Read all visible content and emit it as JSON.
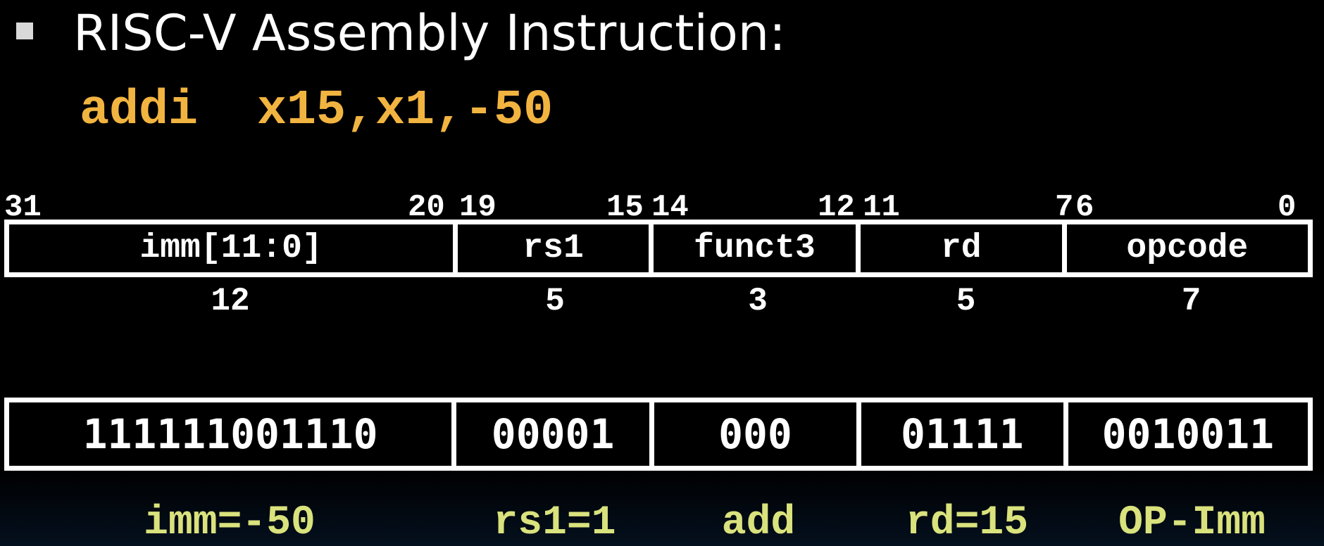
{
  "heading": "RISC-V Assembly Instruction:",
  "assembly": "addi  x15,x1,-50",
  "bit_labels": [
    "31",
    "20",
    "19",
    "15",
    "14",
    "12",
    "11",
    "7",
    "6",
    "0"
  ],
  "fields": [
    {
      "name": "imm[11:0]",
      "width": "12",
      "bits": "111111001110",
      "meaning": "imm=-50"
    },
    {
      "name": "rs1",
      "width": "5",
      "bits": "00001",
      "meaning": "rs1=1"
    },
    {
      "name": "funct3",
      "width": "3",
      "bits": "000",
      "meaning": "add"
    },
    {
      "name": "rd",
      "width": "5",
      "bits": "01111",
      "meaning": "rd=15"
    },
    {
      "name": "opcode",
      "width": "7",
      "bits": "0010011",
      "meaning": "OP-Imm"
    }
  ],
  "colors": {
    "background": "#000000",
    "assembly": "#f2b440",
    "decoded": "#d9e27c",
    "box": "#ffffff"
  }
}
